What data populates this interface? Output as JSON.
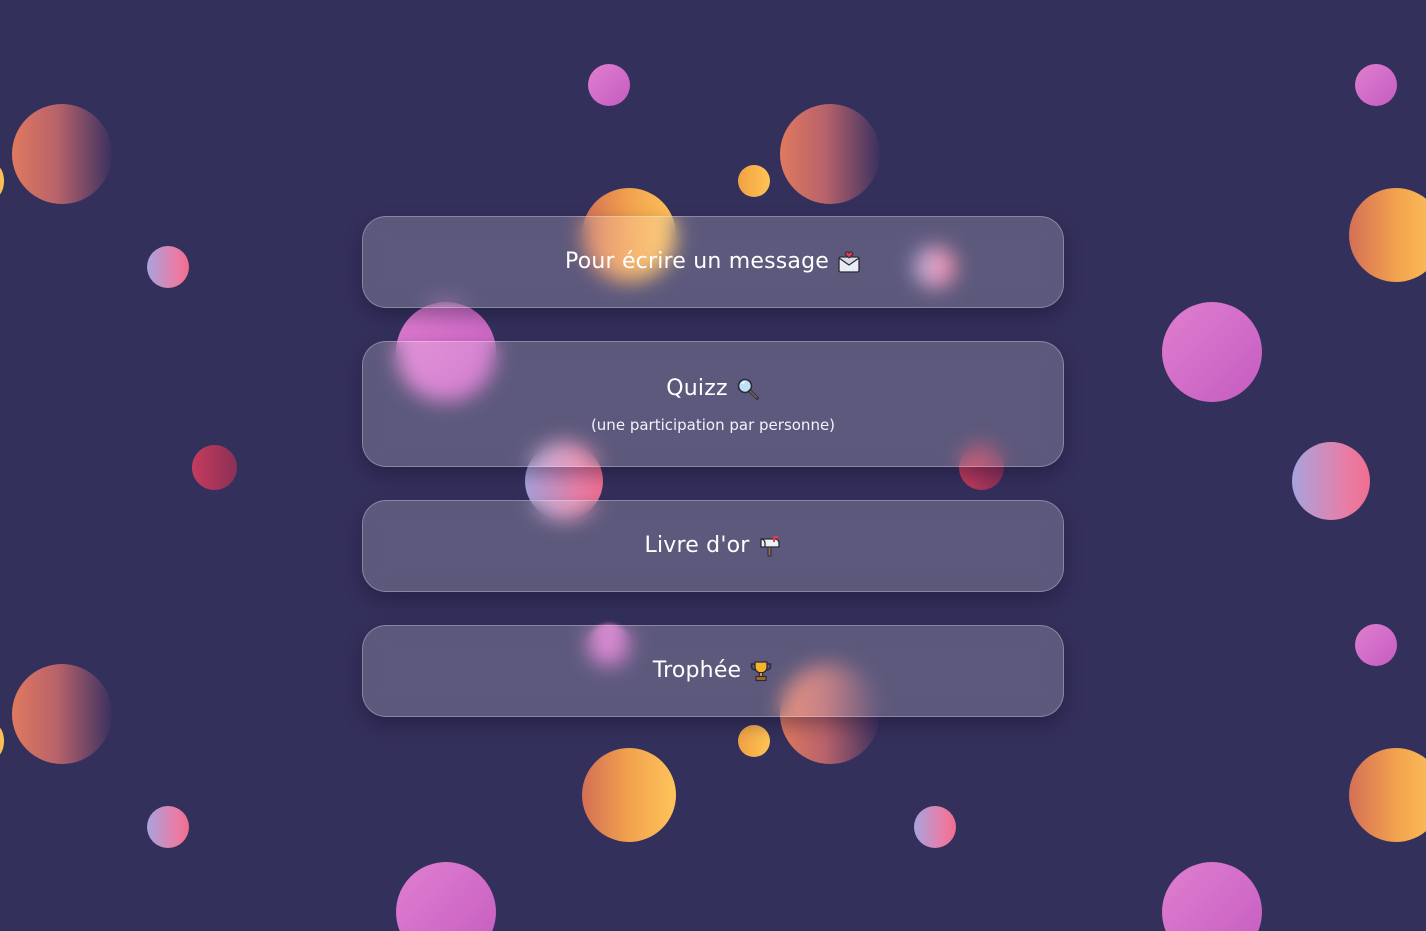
{
  "menu": {
    "items": [
      {
        "label": "Pour écrire un message",
        "icon": "love-letter-icon"
      },
      {
        "label": "Quizz",
        "icon": "magnifying-glass-icon",
        "subtitle": "(une participation par personne)"
      },
      {
        "label": "Livre d'or",
        "icon": "mailbox-icon"
      },
      {
        "label": "Trophée",
        "icon": "trophy-icon"
      }
    ]
  },
  "colors": {
    "background": "#34305c",
    "card": "rgba(255,255,255,0.20)",
    "text": "#ffffff"
  }
}
